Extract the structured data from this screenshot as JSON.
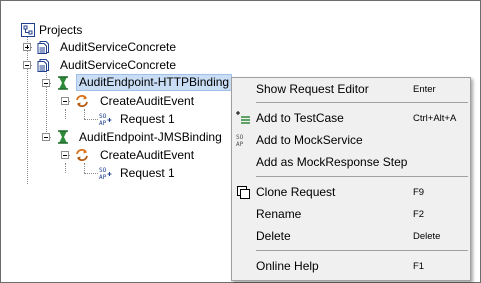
{
  "tree": {
    "root": {
      "label": "Projects",
      "icon": "projects-icon"
    },
    "items": [
      {
        "label": "AuditServiceConcrete",
        "icon": "interface-icon",
        "expander": "plus"
      },
      {
        "label": "AuditServiceConcrete",
        "icon": "interface-icon",
        "expander": "minus"
      },
      {
        "label": "AuditEndpoint-HTTPBinding",
        "icon": "mock-service-icon",
        "expander": "minus",
        "selected": true
      },
      {
        "label": "CreateAuditEvent",
        "icon": "operation-icon",
        "expander": "minus"
      },
      {
        "label": "Request 1",
        "icon": "request-icon"
      },
      {
        "label": "AuditEndpoint-JMSBinding",
        "icon": "mock-service-icon",
        "expander": "minus"
      },
      {
        "label": "CreateAuditEvent",
        "icon": "operation-icon",
        "expander": "minus"
      },
      {
        "label": "Request 1",
        "icon": "request-icon"
      }
    ]
  },
  "menu": {
    "items": [
      {
        "label": "Show Request Editor",
        "shortcut": "Enter",
        "icon": ""
      },
      {
        "label": "Add to TestCase",
        "shortcut": "Ctrl+Alt+A",
        "icon": "add-to-testcase-icon"
      },
      {
        "label": "Add to MockService",
        "shortcut": "",
        "icon": "mock-request-icon"
      },
      {
        "label": "Add as MockResponse Step",
        "shortcut": "",
        "icon": ""
      },
      {
        "label": "Clone Request",
        "shortcut": "F9",
        "icon": "clone-icon"
      },
      {
        "label": "Rename",
        "shortcut": "F2",
        "icon": ""
      },
      {
        "label": "Delete",
        "shortcut": "Delete",
        "icon": ""
      },
      {
        "label": "Online Help",
        "shortcut": "F1",
        "icon": ""
      }
    ]
  },
  "colors": {
    "selection_bg": "#c9def5",
    "selection_border": "#9fc1e8",
    "menu_bg": "#f0f0f0",
    "icon_blue": "#1f3f8f",
    "icon_green": "#2e8b3a",
    "icon_orange": "#d9701b"
  }
}
